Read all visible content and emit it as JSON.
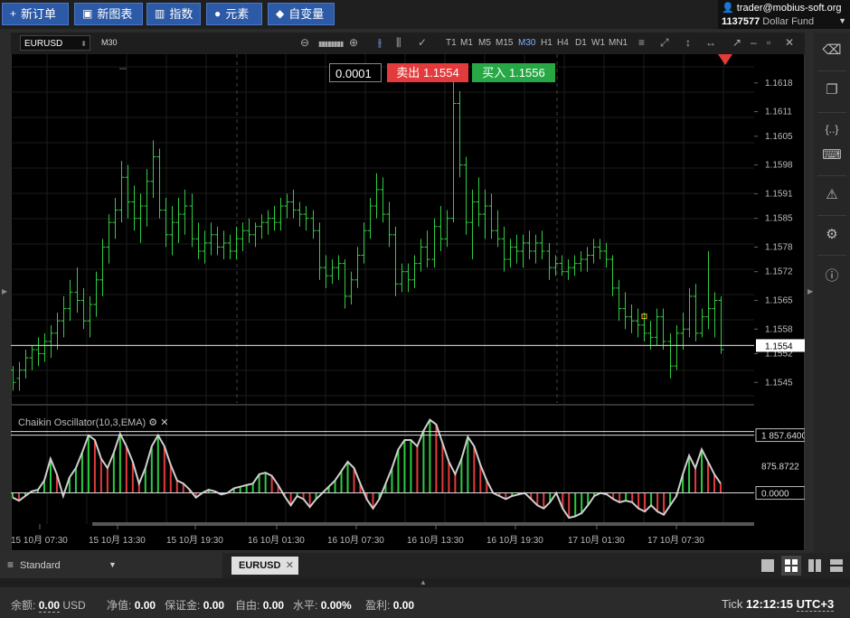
{
  "toolbar": {
    "new_order": "新订单",
    "new_chart": "新图表",
    "indicators": "指数",
    "elements": "元素",
    "variables": "自变量"
  },
  "account": {
    "user": "trader@mobius-soft.org",
    "number": "1137577",
    "fund": "Dollar Fund"
  },
  "chart": {
    "symbol": "EURUSD",
    "timeframe": "M30",
    "timeframes": [
      "T1",
      "M1",
      "M5",
      "M15",
      "M30",
      "H1",
      "H4",
      "D1",
      "W1",
      "MN1"
    ],
    "active_timeframe": "M30",
    "lot": "0.0001",
    "sell_label": "卖出",
    "sell_price": "1.1554",
    "buy_label": "买入",
    "buy_price": "1.1556",
    "current_price_tag": "1.1554",
    "price_axis": [
      "1.1618",
      "1.1611",
      "1.1605",
      "1.1598",
      "1.1591",
      "1.1585",
      "1.1578",
      "1.1572",
      "1.1565",
      "1.1558",
      "1.1552",
      "1.1545"
    ],
    "indicator_name": "Chaikin Oscillator(10,3,EMA)",
    "osc_axis": [
      "1 857.6400",
      "875.8722",
      "0.0000"
    ],
    "time_axis": [
      "15 10月 07:30",
      "15 10月 13:30",
      "15 10月 19:30",
      "16 10月 01:30",
      "16 10月 07:30",
      "16 10月 13:30",
      "16 10月 19:30",
      "17 10月 01:30",
      "17 10月 07:30"
    ]
  },
  "chart_data": {
    "type": "bar",
    "title": "",
    "candles": [
      [
        1.1548,
        1.1549,
        1.1543,
        1.1545
      ],
      [
        1.1546,
        1.155,
        1.1543,
        1.1548
      ],
      [
        1.1548,
        1.1553,
        1.1546,
        1.1551
      ],
      [
        1.1551,
        1.1554,
        1.1548,
        1.1553
      ],
      [
        1.1553,
        1.1556,
        1.1549,
        1.1552
      ],
      [
        1.1552,
        1.1557,
        1.155,
        1.1555
      ],
      [
        1.1555,
        1.1559,
        1.1551,
        1.1557
      ],
      [
        1.1557,
        1.1562,
        1.1553,
        1.156
      ],
      [
        1.156,
        1.1566,
        1.1556,
        1.1563
      ],
      [
        1.1563,
        1.157,
        1.156,
        1.1567
      ],
      [
        1.1567,
        1.1573,
        1.1562,
        1.1565
      ],
      [
        1.1565,
        1.1568,
        1.1558,
        1.156
      ],
      [
        1.156,
        1.1566,
        1.1556,
        1.1564
      ],
      [
        1.1564,
        1.1572,
        1.1561,
        1.157
      ],
      [
        1.157,
        1.158,
        1.1566,
        1.1578
      ],
      [
        1.1578,
        1.1586,
        1.1574,
        1.1584
      ],
      [
        1.1584,
        1.159,
        1.158,
        1.1587
      ],
      [
        1.1587,
        1.1599,
        1.1584,
        1.1595
      ],
      [
        1.1595,
        1.1598,
        1.1585,
        1.1589
      ],
      [
        1.1589,
        1.1593,
        1.1582,
        1.1585
      ],
      [
        1.1585,
        1.1591,
        1.1579,
        1.1588
      ],
      [
        1.1588,
        1.1597,
        1.1583,
        1.1594
      ],
      [
        1.1594,
        1.1604,
        1.159,
        1.16
      ],
      [
        1.16,
        1.1602,
        1.1585,
        1.1587
      ],
      [
        1.1587,
        1.159,
        1.1578,
        1.1581
      ],
      [
        1.1581,
        1.1588,
        1.1576,
        1.1584
      ],
      [
        1.1584,
        1.159,
        1.1579,
        1.1586
      ],
      [
        1.1586,
        1.1592,
        1.1581,
        1.1588
      ],
      [
        1.1588,
        1.1591,
        1.1578,
        1.158
      ],
      [
        1.158,
        1.1584,
        1.1575,
        1.1577
      ],
      [
        1.1577,
        1.1582,
        1.1574,
        1.1579
      ],
      [
        1.1579,
        1.1584,
        1.1576,
        1.1581
      ],
      [
        1.1581,
        1.1583,
        1.1576,
        1.1578
      ],
      [
        1.1578,
        1.1582,
        1.1575,
        1.1579
      ],
      [
        1.1579,
        1.1581,
        1.1575,
        1.1577
      ],
      [
        1.1577,
        1.1583,
        1.1575,
        1.158
      ],
      [
        1.158,
        1.1584,
        1.1577,
        1.1582
      ],
      [
        1.1582,
        1.1585,
        1.1579,
        1.1581
      ],
      [
        1.1581,
        1.1584,
        1.1578,
        1.1583
      ],
      [
        1.1583,
        1.1586,
        1.158,
        1.1584
      ],
      [
        1.1584,
        1.1587,
        1.1581,
        1.1585
      ],
      [
        1.1585,
        1.1588,
        1.1582,
        1.1584
      ],
      [
        1.1584,
        1.159,
        1.1582,
        1.1588
      ],
      [
        1.1588,
        1.1591,
        1.1585,
        1.1589
      ],
      [
        1.1589,
        1.1592,
        1.1585,
        1.1587
      ],
      [
        1.1587,
        1.1589,
        1.1583,
        1.1586
      ],
      [
        1.1586,
        1.1588,
        1.1582,
        1.1585
      ],
      [
        1.1585,
        1.1587,
        1.158,
        1.1582
      ],
      [
        1.1582,
        1.1584,
        1.157,
        1.1573
      ],
      [
        1.1573,
        1.1576,
        1.1568,
        1.1571
      ],
      [
        1.1571,
        1.1575,
        1.1569,
        1.1573
      ],
      [
        1.1573,
        1.1576,
        1.157,
        1.1574
      ],
      [
        1.1574,
        1.1575,
        1.1563,
        1.1566
      ],
      [
        1.1566,
        1.1572,
        1.1564,
        1.157
      ],
      [
        1.157,
        1.1578,
        1.1568,
        1.1576
      ],
      [
        1.1576,
        1.1584,
        1.1574,
        1.1582
      ],
      [
        1.1582,
        1.159,
        1.158,
        1.1588
      ],
      [
        1.1588,
        1.1596,
        1.1585,
        1.1592
      ],
      [
        1.1592,
        1.1595,
        1.1584,
        1.1586
      ],
      [
        1.1586,
        1.1589,
        1.1578,
        1.1581
      ],
      [
        1.1581,
        1.1583,
        1.1566,
        1.1569
      ],
      [
        1.1569,
        1.1574,
        1.1567,
        1.1572
      ],
      [
        1.1572,
        1.1574,
        1.1567,
        1.157
      ],
      [
        1.157,
        1.1576,
        1.1568,
        1.1574
      ],
      [
        1.1574,
        1.158,
        1.1572,
        1.1578
      ],
      [
        1.1578,
        1.1582,
        1.1573,
        1.1575
      ],
      [
        1.1575,
        1.1585,
        1.1573,
        1.1583
      ],
      [
        1.1583,
        1.1588,
        1.1577,
        1.158
      ],
      [
        1.158,
        1.1587,
        1.1578,
        1.1585
      ],
      [
        1.1585,
        1.162,
        1.1584,
        1.1613
      ],
      [
        1.1613,
        1.1616,
        1.1595,
        1.1598
      ],
      [
        1.1598,
        1.16,
        1.1581,
        1.1584
      ],
      [
        1.1584,
        1.1592,
        1.1575,
        1.1589
      ],
      [
        1.1589,
        1.1595,
        1.1583,
        1.1586
      ],
      [
        1.1586,
        1.1592,
        1.158,
        1.1588
      ],
      [
        1.1588,
        1.1591,
        1.158,
        1.1582
      ],
      [
        1.1582,
        1.1587,
        1.1578,
        1.158
      ],
      [
        1.158,
        1.1583,
        1.1572,
        1.1575
      ],
      [
        1.1575,
        1.158,
        1.1573,
        1.1578
      ],
      [
        1.1578,
        1.1581,
        1.1574,
        1.1577
      ],
      [
        1.1577,
        1.1581,
        1.1573,
        1.1579
      ],
      [
        1.1579,
        1.1582,
        1.1575,
        1.1577
      ],
      [
        1.1577,
        1.1581,
        1.1574,
        1.1579
      ],
      [
        1.1579,
        1.1582,
        1.1575,
        1.1577
      ],
      [
        1.1577,
        1.1579,
        1.157,
        1.1573
      ],
      [
        1.1573,
        1.1576,
        1.1571,
        1.1574
      ],
      [
        1.1574,
        1.1576,
        1.1571,
        1.1572
      ],
      [
        1.1572,
        1.1575,
        1.157,
        1.1573
      ],
      [
        1.1573,
        1.1576,
        1.1571,
        1.1574
      ],
      [
        1.1574,
        1.1577,
        1.1572,
        1.1575
      ],
      [
        1.1575,
        1.1578,
        1.1572,
        1.1576
      ],
      [
        1.1576,
        1.158,
        1.1574,
        1.1578
      ],
      [
        1.1578,
        1.158,
        1.1575,
        1.1577
      ],
      [
        1.1577,
        1.1579,
        1.1573,
        1.1575
      ],
      [
        1.1575,
        1.1576,
        1.1566,
        1.1568
      ],
      [
        1.1568,
        1.157,
        1.156,
        1.1563
      ],
      [
        1.1563,
        1.1567,
        1.1558,
        1.1561
      ],
      [
        1.1561,
        1.1564,
        1.1557,
        1.156
      ],
      [
        1.156,
        1.1563,
        1.1556,
        1.1559
      ],
      [
        1.1559,
        1.1562,
        1.1555,
        1.1557
      ],
      [
        1.1557,
        1.156,
        1.1553,
        1.1556
      ],
      [
        1.1556,
        1.1563,
        1.1554,
        1.1561
      ],
      [
        1.1561,
        1.1563,
        1.1553,
        1.1555
      ],
      [
        1.1555,
        1.1557,
        1.1546,
        1.1549
      ],
      [
        1.1549,
        1.1559,
        1.1548,
        1.1557
      ],
      [
        1.1557,
        1.1562,
        1.1553,
        1.1558
      ],
      [
        1.1558,
        1.1568,
        1.1556,
        1.1566
      ],
      [
        1.1566,
        1.1569,
        1.1555,
        1.1557
      ],
      [
        1.1557,
        1.1563,
        1.1556,
        1.1561
      ],
      [
        1.1561,
        1.1577,
        1.1558,
        1.1563
      ],
      [
        1.1563,
        1.1567,
        1.1556,
        1.1565
      ],
      [
        1.1565,
        1.1566,
        1.1552,
        1.1553
      ]
    ],
    "ylim": [
      1.154,
      1.1625
    ],
    "oscillator": [
      -150,
      -250,
      -100,
      50,
      100,
      400,
      1100,
      600,
      -100,
      500,
      800,
      1300,
      1850,
      1700,
      1100,
      800,
      1300,
      1900,
      1500,
      1000,
      300,
      800,
      1500,
      1850,
      1500,
      900,
      400,
      300,
      100,
      -150,
      0,
      100,
      50,
      -50,
      0,
      150,
      200,
      250,
      300,
      600,
      650,
      550,
      250,
      -100,
      -400,
      -100,
      -200,
      -450,
      -200,
      0,
      200,
      400,
      700,
      1000,
      800,
      300,
      -200,
      -500,
      -200,
      300,
      800,
      1400,
      1700,
      1700,
      1500,
      2000,
      2350,
      2200,
      1600,
      1000,
      600,
      1100,
      1800,
      1500,
      900,
      400,
      0,
      -100,
      -200,
      -100,
      -50,
      0,
      -200,
      -400,
      -500,
      -300,
      0,
      -500,
      -800,
      -750,
      -650,
      -400,
      -100,
      0,
      -50,
      -200,
      -300,
      -250,
      -300,
      -500,
      -600,
      -400,
      -600,
      -700,
      -400,
      -100,
      600,
      1200,
      800,
      1400,
      1000,
      600,
      300
    ],
    "osc_ylim": [
      -1000,
      2600
    ]
  },
  "bottom": {
    "template": "Standard",
    "tab": "EURUSD",
    "balance_label": "余额:",
    "balance_value": "0.00",
    "balance_currency": "USD",
    "equity_label": "净值:",
    "equity_value": "0.00",
    "margin_label": "保证金:",
    "margin_value": "0.00",
    "free_label": "自由:",
    "free_value": "0.00",
    "level_label": "水平:",
    "level_value": "0.00%",
    "profit_label": "盈利:",
    "profit_value": "0.00",
    "tick_label": "Tick",
    "clock": "12:12:15",
    "timezone": "UTC+3"
  }
}
